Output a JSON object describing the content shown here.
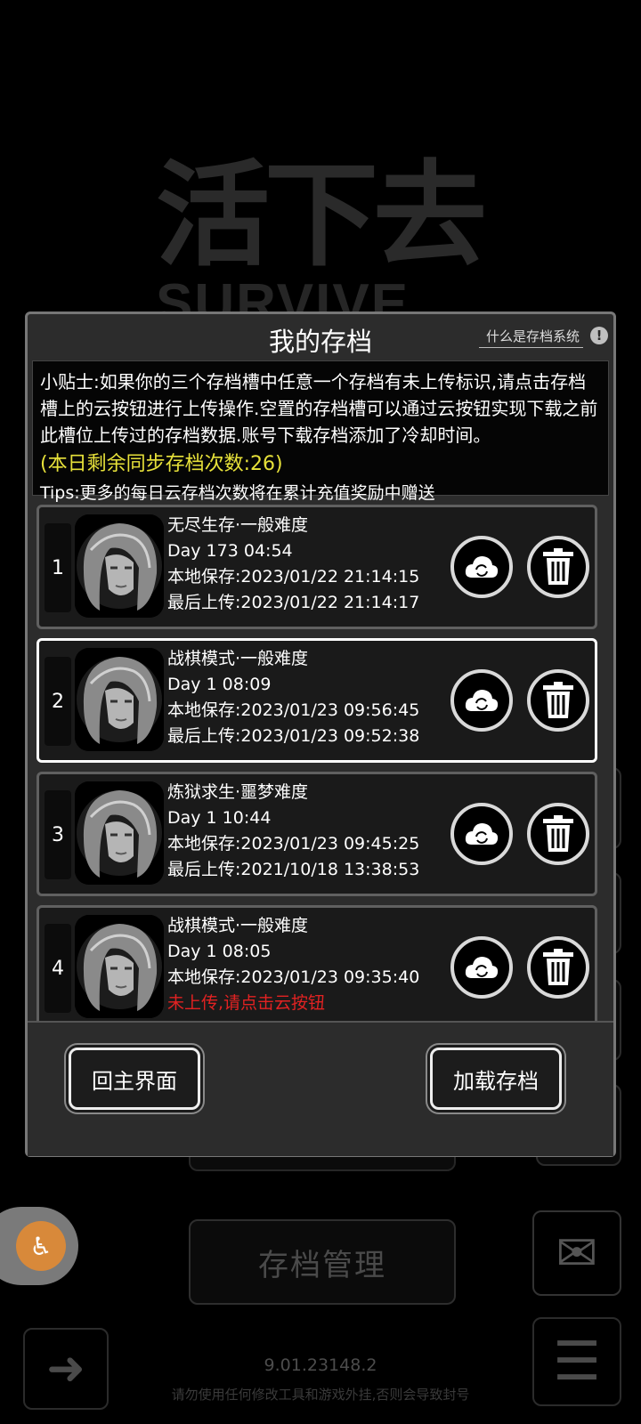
{
  "background": {
    "logo_cn": "活下去",
    "logo_en": "SURVIVE",
    "save_management_label": "存档管理",
    "version": "9.01.23148.2",
    "warning": "请勿使用任何修改工具和游戏外挂,否则会导致封号"
  },
  "dialog": {
    "title": "我的存档",
    "help_link": "什么是存档系统",
    "help_icon": "!",
    "tip_main": "小贴士:如果你的三个存档槽中任意一个存档有未上传标识,请点击存档槽上的云按钮进行上传操作.空置的存档槽可以通过云按钮实现下载之前此槽位上传过的存档数据.账号下载存档添加了冷却时间。",
    "tip_count": "(本日剩余同步存档次数:26)",
    "tip_extra": "Tips:更多的每日云存档次数将在累计充值奖励中赠送",
    "slots": [
      {
        "number": "1",
        "mode": "无尽生存·一般难度",
        "day": "Day 173  04:54",
        "local_save": "本地保存:2023/01/22  21:14:15",
        "last_upload": "最后上传:2023/01/22  21:14:17"
      },
      {
        "number": "2",
        "mode": "战棋模式·一般难度",
        "day": "Day 1  08:09",
        "local_save": "本地保存:2023/01/23  09:56:45",
        "last_upload": "最后上传:2023/01/23  09:52:38"
      },
      {
        "number": "3",
        "mode": "炼狱求生·噩梦难度",
        "day": "Day 1  10:44",
        "local_save": "本地保存:2023/01/23  09:45:25",
        "last_upload": "最后上传:2021/10/18  13:38:53"
      },
      {
        "number": "4",
        "mode": "战棋模式·一般难度",
        "day": "Day 1  08:05",
        "local_save": "本地保存:2023/01/23  09:35:40",
        "last_upload": "未上传,请点击云按钮"
      }
    ],
    "home_button": "回主界面",
    "load_button": "加载存档"
  },
  "colors": {
    "tip_count": "#e7e13a",
    "not_uploaded": "#e22222",
    "accessibility": "#d8893a"
  },
  "icons": [
    "cloud-sync-icon",
    "trash-icon",
    "help-icon",
    "accessibility-icon",
    "exit-icon",
    "menu-icon",
    "mail-icon",
    "character-portrait"
  ]
}
